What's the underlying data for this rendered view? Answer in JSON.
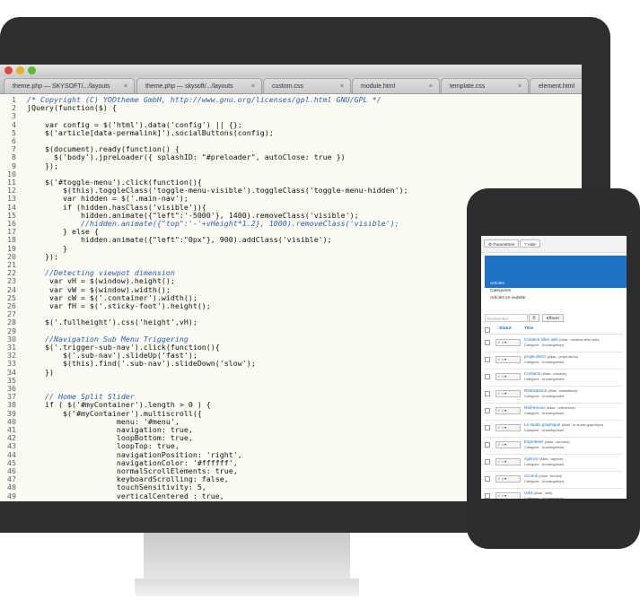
{
  "editor": {
    "tabs": [
      {
        "label": "theme.php — SKYSOFT/.../layouts",
        "close": "×"
      },
      {
        "label": "theme.php — skysoft/.../layouts",
        "close": "×"
      },
      {
        "label": "custom.css",
        "close": "×"
      },
      {
        "label": "module.html",
        "close": "×"
      },
      {
        "label": "template.css",
        "close": "×"
      },
      {
        "label": "element.html",
        "close": ""
      }
    ],
    "lines": [
      {
        "n": "1",
        "c": "/* Copyright (C) YOOtheme GmbH, http://www.gnu.org/licenses/gpl.html GNU/GPL */",
        "cls": "cm"
      },
      {
        "n": "2",
        "c": "jQuery(function($) {",
        "cls": ""
      },
      {
        "n": "3",
        "c": "",
        "cls": ""
      },
      {
        "n": "4",
        "c": "    var config = $('html').data('config') || {};",
        "cls": ""
      },
      {
        "n": "5",
        "c": "    $('article[data-permalink]').socialButtons(config);",
        "cls": ""
      },
      {
        "n": "6",
        "c": "",
        "cls": ""
      },
      {
        "n": "7",
        "c": "    $(document).ready(function() {",
        "cls": ""
      },
      {
        "n": "8",
        "c": "      $('body').jpreLoader({ splashID: \"#preloader\", autoClose: true })",
        "cls": ""
      },
      {
        "n": "9",
        "c": "    });",
        "cls": ""
      },
      {
        "n": "10",
        "c": "",
        "cls": ""
      },
      {
        "n": "11",
        "c": "    $('#toggle-menu').click(function(){",
        "cls": ""
      },
      {
        "n": "12",
        "c": "        $(this).toggleClass('toggle-menu-visible').toggleClass('toggle-menu-hidden');",
        "cls": ""
      },
      {
        "n": "13",
        "c": "        var hidden = $('.main-nav');",
        "cls": ""
      },
      {
        "n": "14",
        "c": "        if (hidden.hasClass('visible')){",
        "cls": ""
      },
      {
        "n": "15",
        "c": "            hidden.animate({\"left\":'-5000'}, 1400).removeClass('visible');",
        "cls": ""
      },
      {
        "n": "16",
        "c": "            //hidden.animate({\"top\":'-'+vHeight*1.2}, 1000).removeClass('visible');",
        "cls": "cm"
      },
      {
        "n": "17",
        "c": "        } else {",
        "cls": ""
      },
      {
        "n": "18",
        "c": "            hidden.animate({\"left\":\"0px\"}, 900).addClass('visible');",
        "cls": ""
      },
      {
        "n": "19",
        "c": "        }",
        "cls": ""
      },
      {
        "n": "20",
        "c": "    });",
        "cls": ""
      },
      {
        "n": "21",
        "c": "",
        "cls": ""
      },
      {
        "n": "22",
        "c": "    //Detecting viewpot dimension",
        "cls": "cm"
      },
      {
        "n": "23",
        "c": "     var vH = $(window).height();",
        "cls": ""
      },
      {
        "n": "24",
        "c": "     var vW = $(window).width();",
        "cls": ""
      },
      {
        "n": "25",
        "c": "     var cW = $('.container').width();",
        "cls": ""
      },
      {
        "n": "26",
        "c": "     var fH = $('.sticky-foot').height();",
        "cls": ""
      },
      {
        "n": "27",
        "c": "",
        "cls": ""
      },
      {
        "n": "28",
        "c": "    $('.fullheight').css('height',vH);",
        "cls": ""
      },
      {
        "n": "29",
        "c": "",
        "cls": ""
      },
      {
        "n": "30",
        "c": "    //Navigation Sub Menu Triggering",
        "cls": "cm"
      },
      {
        "n": "31",
        "c": "    $('.trigger-sub-nav').click(function(){",
        "cls": ""
      },
      {
        "n": "32",
        "c": "        $('.sub-nav').slideUp('fast');",
        "cls": ""
      },
      {
        "n": "33",
        "c": "        $(this).find('.sub-nav').slideDown('slow');",
        "cls": ""
      },
      {
        "n": "34",
        "c": "    })",
        "cls": ""
      },
      {
        "n": "35",
        "c": "",
        "cls": ""
      },
      {
        "n": "36",
        "c": "",
        "cls": ""
      },
      {
        "n": "37",
        "c": "    // Home Split Slider",
        "cls": "cm"
      },
      {
        "n": "38",
        "c": "    if ( $('#myContainer').length > 0 ) {",
        "cls": ""
      },
      {
        "n": "39",
        "c": "        $('#myContainer').multiscroll({",
        "cls": ""
      },
      {
        "n": "40",
        "c": "                    menu: '#menu',",
        "cls": ""
      },
      {
        "n": "41",
        "c": "                    navigation: true,",
        "cls": ""
      },
      {
        "n": "42",
        "c": "                    loopBottom: true,",
        "cls": ""
      },
      {
        "n": "43",
        "c": "                    loopTop: true,",
        "cls": ""
      },
      {
        "n": "44",
        "c": "                    navigationPosition: 'right',",
        "cls": ""
      },
      {
        "n": "45",
        "c": "                    navigationColor: '#ffffff',",
        "cls": ""
      },
      {
        "n": "46",
        "c": "                    normalScrollElements: true,",
        "cls": ""
      },
      {
        "n": "47",
        "c": "                    keyboardScrolling: false,",
        "cls": ""
      },
      {
        "n": "48",
        "c": "                    touchSensitivity: 5,",
        "cls": ""
      },
      {
        "n": "49",
        "c": "                    verticalCentered : true,",
        "cls": ""
      }
    ]
  },
  "phone": {
    "toolbar": {
      "params": "Paramètres",
      "help": "Aide"
    },
    "menu": [
      "Articles",
      "Catégories",
      "Articles en vedette"
    ],
    "search_placeholder": "Rechercher",
    "search_icon": "search-icon",
    "clear_label": "Effacer",
    "columns": {
      "status": "Statut",
      "title": "Titre"
    },
    "rows": [
      {
        "title": "Création sites web",
        "alias": "(Alias : creation-sites-web)",
        "category": "Catégorie : Uncategorised"
      },
      {
        "title": "projet-demo",
        "alias": "(Alias : projet-demo)",
        "category": "Catégorie : Uncategorised"
      },
      {
        "title": "Contacts",
        "alias": "(Alias : contacts)",
        "category": "Catégorie : Uncategorised"
      },
      {
        "title": "Réalisations",
        "alias": "(Alias : realisations)",
        "category": "Catégorie : Uncategorised"
      },
      {
        "title": "Références",
        "alias": "(Alias : references)",
        "category": "Catégorie : Uncategorised"
      },
      {
        "title": "Le studio graphique",
        "alias": "(Alias : le-studio-graphique)",
        "category": "Catégorie : Uncategorised"
      },
      {
        "title": "Expertises",
        "alias": "(Alias : services)",
        "category": "Catégorie : Uncategorised"
      },
      {
        "title": "Agence",
        "alias": "(Alias : agence)",
        "category": "Catégorie : Uncategorised"
      },
      {
        "title": "Acceuil",
        "alias": "(Alias : accueil)",
        "category": "Catégorie : Uncategorised"
      },
      {
        "title": "Utkit",
        "alias": "(Alias : utkit)",
        "category": "Catégorie : Uncategorised"
      }
    ]
  },
  "colors": {
    "accent": "#1e72c8",
    "bezel": "#2f2f2f",
    "editor_bg": "#fbfbf3"
  }
}
